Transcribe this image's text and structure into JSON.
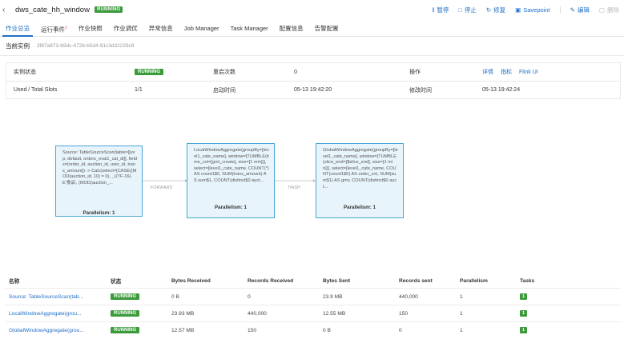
{
  "header": {
    "back_glyph": "‹",
    "title": "dws_cate_hh_window",
    "status": "RUNNING",
    "actions": [
      {
        "icon": "pause-icon",
        "glyph": "‖",
        "label": "暂停"
      },
      {
        "icon": "stop-icon",
        "glyph": "□",
        "label": "停止"
      },
      {
        "icon": "repair-icon",
        "glyph": "↻",
        "label": "修复"
      },
      {
        "icon": "savepoint-icon",
        "glyph": "▣",
        "label": "Savepoint"
      },
      {
        "icon": "edit-icon",
        "glyph": "✎",
        "label": "编辑"
      },
      {
        "icon": "delete-icon",
        "glyph": "▢",
        "label": "删除"
      }
    ]
  },
  "tabs": [
    "作业总览",
    "运行事件",
    "作业快照",
    "作业调优",
    "异常信息",
    "Job Manager",
    "Task Manager",
    "配置信息",
    "告警配置"
  ],
  "tab_badge": "1",
  "instance": {
    "label": "当前实例",
    "id": "3f87a873-69dc-472b-b5d4-91c3d32229c8"
  },
  "info": {
    "row1": {
      "k1": "实例状态",
      "v1": "RUNNING",
      "k2": "重启次数",
      "v2": "0",
      "k3": "操作",
      "links": [
        "详情",
        "指标",
        "Flink UI"
      ]
    },
    "row2": {
      "k1": "Used / Total Slots",
      "v1": "1/1",
      "k2": "启动时间",
      "v2": "05-13 19:42:20",
      "k3": "修改时间",
      "v3": "05-13 19:42:24"
    }
  },
  "graph": {
    "nodes": [
      {
        "text": "Source: TableSourceScan(table=[[vvp, default, orders_eval1_cat_dl]], fields=[order_id, auction_id, user_id, trans_amount]) -> Calc(select=[CASE((MOD(auction_id, 10) = 0), _UTF-16LE'食品', (MOD(auction_...",
        "parallelism": "Parallelism: 1"
      },
      {
        "text": "LocalWindowAggregate(groupBy=[level1_cate_name], window=[TUMBLE(time_col=[gmt_create], size=[1 min])], select=[level1_cate_name, COUNT(*) AS count1$0, SUM(trans_amount) AS sum$1, COUNT(distinct$0 auct...",
        "parallelism": "Parallelism: 1"
      },
      {
        "text": "GlobalWindowAggregate(groupBy=[level1_cate_name], window=[TUMBLE(slice_end=[$slice_end], size=[1 min])], select=[level1_cate_name, COUNT(count1$0) AS order_cnt, SUM(sum$1) AS gmv, COUNT(distinct$0 auct...",
        "parallelism": "Parallelism: 1"
      }
    ],
    "edges": [
      "FORWARD",
      "HASH"
    ]
  },
  "table": {
    "headers": [
      "名称",
      "状态",
      "Bytes Received",
      "Records Received",
      "Bytes Sent",
      "Records sent",
      "Parallelism",
      "Tasks"
    ],
    "rows": [
      {
        "name": "Source: TableSourceScan(tab...",
        "status": "RUNNING",
        "bytes_received": "0 B",
        "records_received": "0",
        "bytes_sent": "23.9 MB",
        "records_sent": "440,000",
        "parallelism": "1",
        "tasks": "1"
      },
      {
        "name": "LocalWindowAggregate(grou...",
        "status": "RUNNING",
        "bytes_received": "23.93 MB",
        "records_received": "440,000",
        "bytes_sent": "12.55 MB",
        "records_sent": "150",
        "parallelism": "1",
        "tasks": "1"
      },
      {
        "name": "GlobalWindowAggregate(grou...",
        "status": "RUNNING",
        "bytes_received": "12.57 MB",
        "records_received": "150",
        "bytes_sent": "0 B",
        "records_sent": "0",
        "parallelism": "1",
        "tasks": "1"
      }
    ]
  },
  "colors": {
    "accent": "#1f6fc5",
    "running": "#3b9b3b",
    "node_border": "#49a5d4",
    "node_fill": "#e8f4fb"
  }
}
